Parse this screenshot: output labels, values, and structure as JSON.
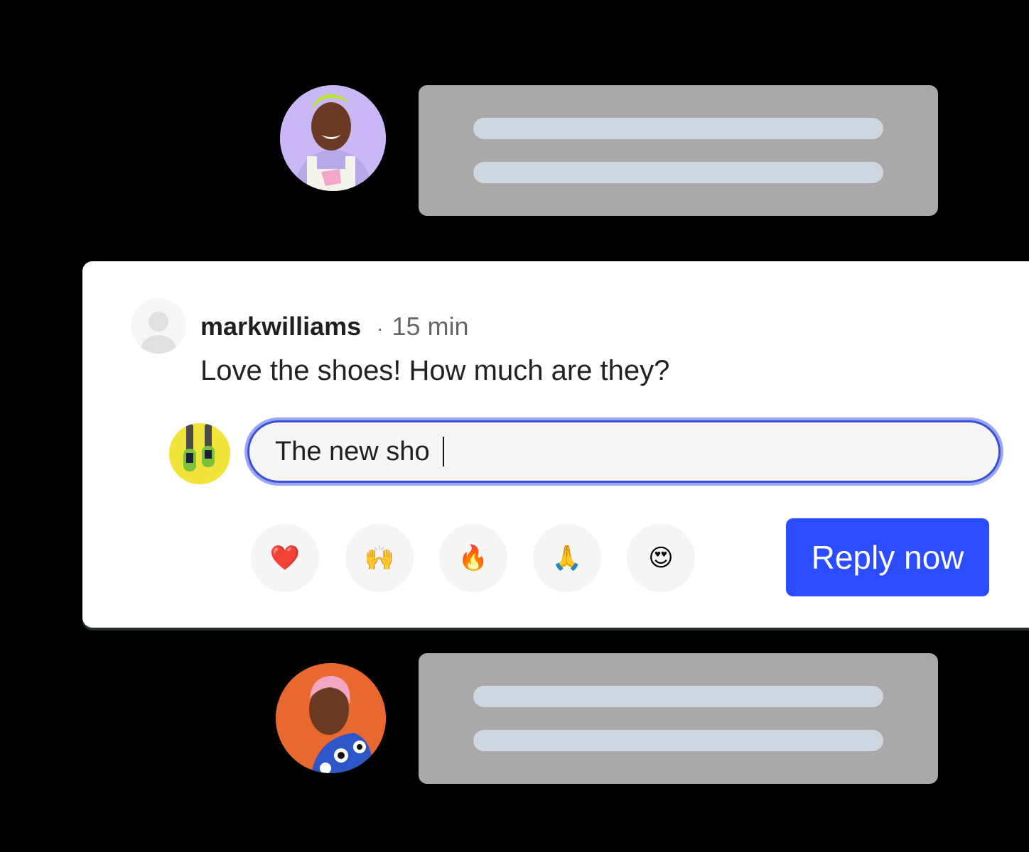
{
  "background_threads": [
    {
      "avatar": "avatar-laughing-person-lavender",
      "avatar_bg": "#c9b8f5"
    },
    {
      "avatar": "avatar-pink-hair-person-orange",
      "avatar_bg": "#e8682f"
    }
  ],
  "comment": {
    "username": "markwilliams",
    "separator": "·",
    "time": "15 min",
    "text": "Love the shoes! How much are they?"
  },
  "reply": {
    "input_value": "The new sho",
    "avatar": "avatar-shoes-yellow"
  },
  "reactions": [
    {
      "name": "heart",
      "glyph": "❤️"
    },
    {
      "name": "raising-hands",
      "glyph": "🙌"
    },
    {
      "name": "fire",
      "glyph": "🔥"
    },
    {
      "name": "folded-hands",
      "glyph": "🙏"
    },
    {
      "name": "heart-eyes",
      "glyph": "😍"
    }
  ],
  "actions": {
    "reply_label": "Reply now"
  },
  "colors": {
    "accent": "#2b4cff",
    "input_border": "#3b4fd8",
    "placeholder_card": "#a9a9a9",
    "placeholder_line": "#cfd6e0"
  }
}
